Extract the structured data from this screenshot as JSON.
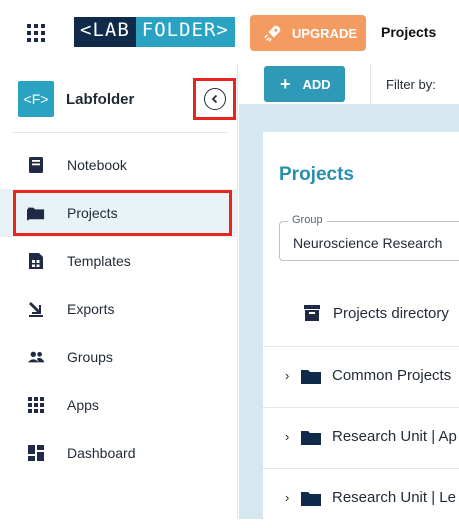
{
  "topbar": {
    "logo_left": "<LAB",
    "logo_right": "FOLDER>",
    "upgrade_label": "UPGRADE",
    "nav_title": "Projects"
  },
  "sidebar": {
    "brand_icon_text": "<F>",
    "brand_name": "Labfolder",
    "items": [
      {
        "label": "Notebook",
        "icon": "notebook-icon"
      },
      {
        "label": "Projects",
        "icon": "folder-icon",
        "active": true
      },
      {
        "label": "Templates",
        "icon": "template-icon"
      },
      {
        "label": "Exports",
        "icon": "export-icon"
      },
      {
        "label": "Groups",
        "icon": "groups-icon"
      },
      {
        "label": "Apps",
        "icon": "apps-icon"
      },
      {
        "label": "Dashboard",
        "icon": "dashboard-icon"
      }
    ]
  },
  "toolbar": {
    "add_label": "ADD",
    "filter_label": "Filter by:"
  },
  "main": {
    "title": "Projects",
    "group_label": "Group",
    "group_value": "Neuroscience Research",
    "directory_label": "Projects directory",
    "rows": [
      {
        "label": "Common Projects"
      },
      {
        "label": "Research Unit | Ap"
      },
      {
        "label": "Research Unit | Le"
      }
    ]
  },
  "colors": {
    "accent": "#2aa3c2",
    "upgrade": "#f39b61",
    "highlight": "#e8251c",
    "navy": "#0f2b49"
  }
}
